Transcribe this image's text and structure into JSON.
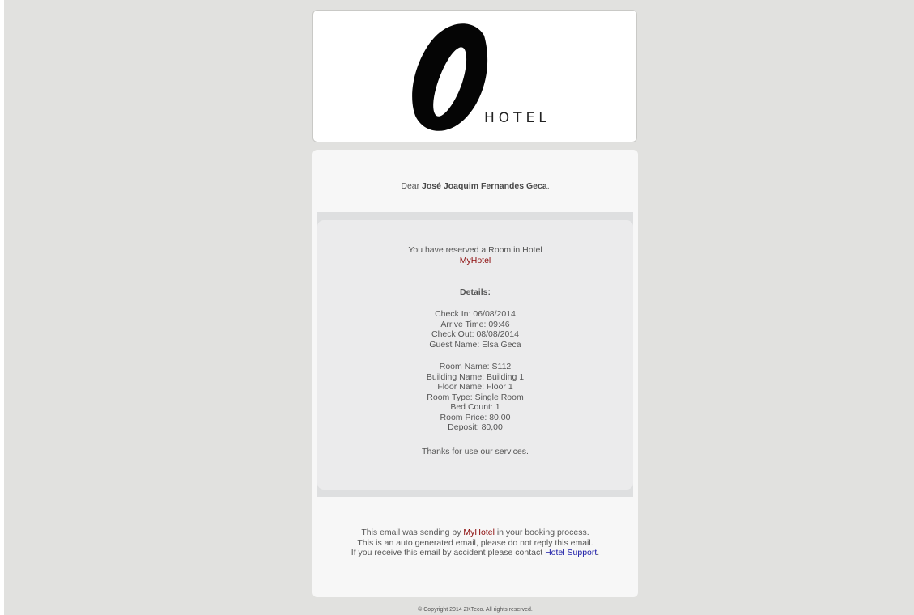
{
  "logo": {
    "text": "HOTEL",
    "icon": "hotel-o-logo"
  },
  "greeting": {
    "prefix": "Dear ",
    "name": "José Joaquim Fernandes Geca",
    "suffix": "."
  },
  "reservation": {
    "intro": "You have reserved a Room in Hotel",
    "hotel_name": "MyHotel",
    "details_title": "Details:",
    "check_in": "Check In: 06/08/2014",
    "arrive_time": "Arrive Time: 09:46",
    "check_out": "Check Out: 08/08/2014",
    "guest_name": "Guest Name: Elsa Geca",
    "room_name": "Room Name: S112",
    "building_name": "Building Name: Building 1",
    "floor_name": "Floor Name: Floor 1",
    "room_type": "Room Type: Single Room",
    "bed_count": "Bed Count: 1",
    "room_price": "Room Price: 80,00",
    "deposit": "Deposit: 80,00",
    "thanks": "Thanks for use our services."
  },
  "footer": {
    "line1_prefix": "This email was sending by ",
    "line1_hotel": "MyHotel",
    "line1_suffix": " in your booking process.",
    "line2": "This is an auto generated email, please do not reply this email.",
    "line3_prefix": "If you receive this email by accident please contact ",
    "line3_link": "Hotel Support",
    "line3_suffix": "."
  },
  "copyright": "© Copyright 2014 ZKTeco. All rights reserved.",
  "colors": {
    "background": "#e1e1df",
    "card": "#f7f7f7",
    "inner_panel": "#ebebec",
    "hotel_link": "#8b0a0a",
    "support_link": "#1a1aa6"
  }
}
